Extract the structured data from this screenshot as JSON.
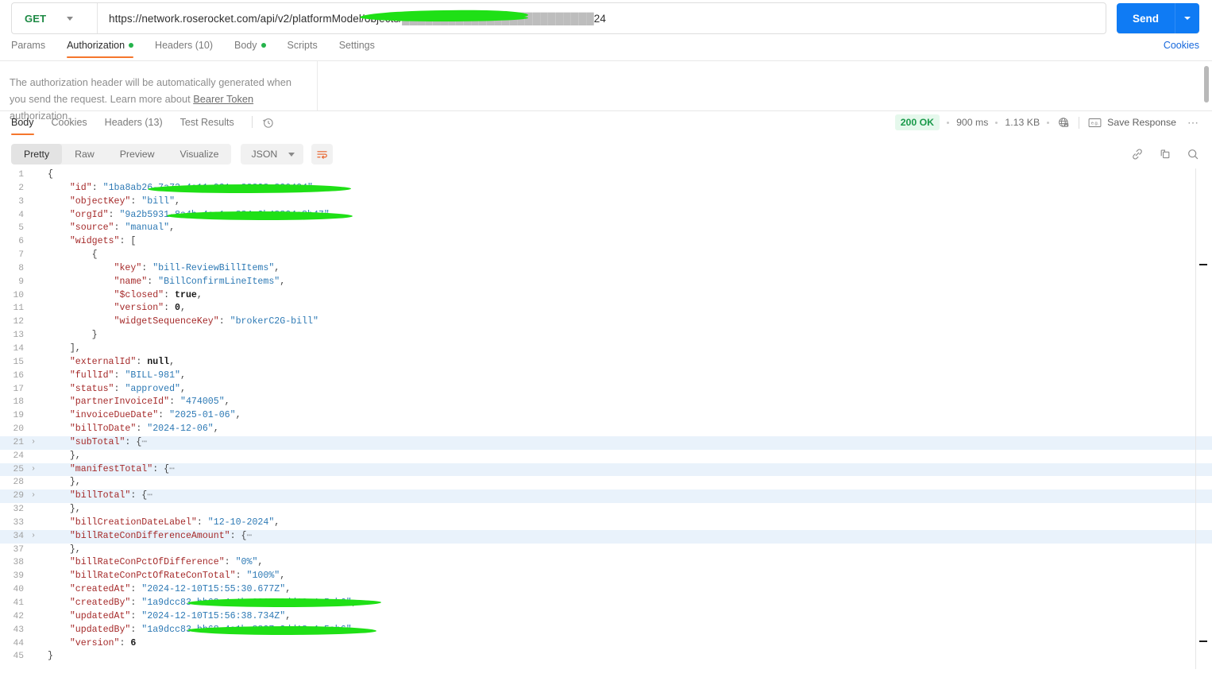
{
  "request": {
    "method": "GET",
    "url": "https://network.roserocket.com/api/v2/platformModel/objects/",
    "url_tail": "24",
    "send_label": "Send",
    "tabs": [
      {
        "label": "Params",
        "active": false,
        "dot": false
      },
      {
        "label": "Authorization",
        "active": true,
        "dot": true
      },
      {
        "label": "Headers (10)",
        "active": false,
        "dot": false
      },
      {
        "label": "Body",
        "active": false,
        "dot": true
      },
      {
        "label": "Scripts",
        "active": false,
        "dot": false
      },
      {
        "label": "Settings",
        "active": false,
        "dot": false
      }
    ],
    "cookies_link": "Cookies"
  },
  "auth": {
    "text_before": "The authorization header will be automatically generated when you send the request. Learn more about ",
    "link": "Bearer Token",
    "text_after": " authorization."
  },
  "response": {
    "tabs": [
      {
        "label": "Body",
        "active": true
      },
      {
        "label": "Cookies",
        "active": false
      },
      {
        "label": "Headers (13)",
        "active": false
      },
      {
        "label": "Test Results",
        "active": false
      }
    ],
    "status": "200 OK",
    "time": "900 ms",
    "size": "1.13 KB",
    "save_response": "Save Response",
    "status_color": "#1b9a4b",
    "status_bg": "#e5f8ec"
  },
  "format": {
    "segments": [
      {
        "label": "Pretty",
        "active": true
      },
      {
        "label": "Raw",
        "active": false
      },
      {
        "label": "Preview",
        "active": false
      },
      {
        "label": "Visualize",
        "active": false
      }
    ],
    "language": "JSON",
    "accent": "#f5762c"
  },
  "code": {
    "lines": [
      {
        "no": "1",
        "indent": 0,
        "fold": "",
        "hl": false,
        "tokens": [
          {
            "t": "{",
            "c": "p"
          }
        ]
      },
      {
        "no": "2",
        "indent": 1,
        "fold": "",
        "hl": false,
        "redact": "r-id",
        "tokens": [
          {
            "t": "\"id\"",
            "c": "k"
          },
          {
            "t": ": ",
            "c": "p"
          },
          {
            "t": "\"1ba8ab26-7a73-4a11-921a-88828a820424\"",
            "c": "s"
          },
          {
            "t": ",",
            "c": "p"
          }
        ]
      },
      {
        "no": "3",
        "indent": 1,
        "fold": "",
        "hl": false,
        "tokens": [
          {
            "t": "\"objectKey\"",
            "c": "k"
          },
          {
            "t": ": ",
            "c": "p"
          },
          {
            "t": "\"bill\"",
            "c": "s"
          },
          {
            "t": ",",
            "c": "p"
          }
        ]
      },
      {
        "no": "4",
        "indent": 1,
        "fold": "",
        "hl": false,
        "redact": "r-org",
        "tokens": [
          {
            "t": "\"orgId\"",
            "c": "k"
          },
          {
            "t": ": ",
            "c": "p"
          },
          {
            "t": "\"9a2b5931-8a4b-4aa1-a884-3b48824a8b47\"",
            "c": "s"
          },
          {
            "t": ",",
            "c": "p"
          }
        ]
      },
      {
        "no": "5",
        "indent": 1,
        "fold": "",
        "hl": false,
        "tokens": [
          {
            "t": "\"source\"",
            "c": "k"
          },
          {
            "t": ": ",
            "c": "p"
          },
          {
            "t": "\"manual\"",
            "c": "s"
          },
          {
            "t": ",",
            "c": "p"
          }
        ]
      },
      {
        "no": "6",
        "indent": 1,
        "fold": "",
        "hl": false,
        "tokens": [
          {
            "t": "\"widgets\"",
            "c": "k"
          },
          {
            "t": ": ",
            "c": "p"
          },
          {
            "t": "[",
            "c": "p"
          }
        ]
      },
      {
        "no": "7",
        "indent": 2,
        "fold": "",
        "hl": false,
        "tokens": [
          {
            "t": "{",
            "c": "p"
          }
        ]
      },
      {
        "no": "8",
        "indent": 3,
        "fold": "",
        "hl": false,
        "tokens": [
          {
            "t": "\"key\"",
            "c": "k"
          },
          {
            "t": ": ",
            "c": "p"
          },
          {
            "t": "\"bill-ReviewBillItems\"",
            "c": "s"
          },
          {
            "t": ",",
            "c": "p"
          }
        ]
      },
      {
        "no": "9",
        "indent": 3,
        "fold": "",
        "hl": false,
        "tokens": [
          {
            "t": "\"name\"",
            "c": "k"
          },
          {
            "t": ": ",
            "c": "p"
          },
          {
            "t": "\"BillConfirmLineItems\"",
            "c": "s"
          },
          {
            "t": ",",
            "c": "p"
          }
        ]
      },
      {
        "no": "10",
        "indent": 3,
        "fold": "",
        "hl": false,
        "tokens": [
          {
            "t": "\"$closed\"",
            "c": "k"
          },
          {
            "t": ": ",
            "c": "p"
          },
          {
            "t": "true",
            "c": "n"
          },
          {
            "t": ",",
            "c": "p"
          }
        ]
      },
      {
        "no": "11",
        "indent": 3,
        "fold": "",
        "hl": false,
        "tokens": [
          {
            "t": "\"version\"",
            "c": "k"
          },
          {
            "t": ": ",
            "c": "p"
          },
          {
            "t": "0",
            "c": "n"
          },
          {
            "t": ",",
            "c": "p"
          }
        ]
      },
      {
        "no": "12",
        "indent": 3,
        "fold": "",
        "hl": false,
        "tokens": [
          {
            "t": "\"widgetSequenceKey\"",
            "c": "k"
          },
          {
            "t": ": ",
            "c": "p"
          },
          {
            "t": "\"brokerC2G-bill\"",
            "c": "s"
          }
        ]
      },
      {
        "no": "13",
        "indent": 2,
        "fold": "",
        "hl": false,
        "tokens": [
          {
            "t": "}",
            "c": "p"
          }
        ]
      },
      {
        "no": "14",
        "indent": 1,
        "fold": "",
        "hl": false,
        "tokens": [
          {
            "t": "],",
            "c": "p"
          }
        ]
      },
      {
        "no": "15",
        "indent": 1,
        "fold": "",
        "hl": false,
        "tokens": [
          {
            "t": "\"externalId\"",
            "c": "k"
          },
          {
            "t": ": ",
            "c": "p"
          },
          {
            "t": "null",
            "c": "n"
          },
          {
            "t": ",",
            "c": "p"
          }
        ]
      },
      {
        "no": "16",
        "indent": 1,
        "fold": "",
        "hl": false,
        "tokens": [
          {
            "t": "\"fullId\"",
            "c": "k"
          },
          {
            "t": ": ",
            "c": "p"
          },
          {
            "t": "\"BILL-981\"",
            "c": "s"
          },
          {
            "t": ",",
            "c": "p"
          }
        ]
      },
      {
        "no": "17",
        "indent": 1,
        "fold": "",
        "hl": false,
        "tokens": [
          {
            "t": "\"status\"",
            "c": "k"
          },
          {
            "t": ": ",
            "c": "p"
          },
          {
            "t": "\"approved\"",
            "c": "s"
          },
          {
            "t": ",",
            "c": "p"
          }
        ]
      },
      {
        "no": "18",
        "indent": 1,
        "fold": "",
        "hl": false,
        "tokens": [
          {
            "t": "\"partnerInvoiceId\"",
            "c": "k"
          },
          {
            "t": ": ",
            "c": "p"
          },
          {
            "t": "\"474005\"",
            "c": "s"
          },
          {
            "t": ",",
            "c": "p"
          }
        ]
      },
      {
        "no": "19",
        "indent": 1,
        "fold": "",
        "hl": false,
        "tokens": [
          {
            "t": "\"invoiceDueDate\"",
            "c": "k"
          },
          {
            "t": ": ",
            "c": "p"
          },
          {
            "t": "\"2025-01-06\"",
            "c": "s"
          },
          {
            "t": ",",
            "c": "p"
          }
        ]
      },
      {
        "no": "20",
        "indent": 1,
        "fold": "",
        "hl": false,
        "tokens": [
          {
            "t": "\"billToDate\"",
            "c": "k"
          },
          {
            "t": ": ",
            "c": "p"
          },
          {
            "t": "\"2024-12-06\"",
            "c": "s"
          },
          {
            "t": ",",
            "c": "p"
          }
        ]
      },
      {
        "no": "21",
        "indent": 1,
        "fold": "›",
        "hl": true,
        "tokens": [
          {
            "t": "\"subTotal\"",
            "c": "k"
          },
          {
            "t": ": ",
            "c": "p"
          },
          {
            "t": "{",
            "c": "p"
          },
          {
            "t": "⋯",
            "c": "fade"
          }
        ]
      },
      {
        "no": "24",
        "indent": 1,
        "fold": "",
        "hl": false,
        "tokens": [
          {
            "t": "},",
            "c": "p"
          }
        ]
      },
      {
        "no": "25",
        "indent": 1,
        "fold": "›",
        "hl": true,
        "tokens": [
          {
            "t": "\"manifestTotal\"",
            "c": "k"
          },
          {
            "t": ": ",
            "c": "p"
          },
          {
            "t": "{",
            "c": "p"
          },
          {
            "t": "⋯",
            "c": "fade"
          }
        ]
      },
      {
        "no": "28",
        "indent": 1,
        "fold": "",
        "hl": false,
        "tokens": [
          {
            "t": "},",
            "c": "p"
          }
        ]
      },
      {
        "no": "29",
        "indent": 1,
        "fold": "›",
        "hl": true,
        "tokens": [
          {
            "t": "\"billTotal\"",
            "c": "k"
          },
          {
            "t": ": ",
            "c": "p"
          },
          {
            "t": "{",
            "c": "p"
          },
          {
            "t": "⋯",
            "c": "fade"
          }
        ]
      },
      {
        "no": "32",
        "indent": 1,
        "fold": "",
        "hl": false,
        "tokens": [
          {
            "t": "},",
            "c": "p"
          }
        ]
      },
      {
        "no": "33",
        "indent": 1,
        "fold": "",
        "hl": false,
        "tokens": [
          {
            "t": "\"billCreationDateLabel\"",
            "c": "k"
          },
          {
            "t": ": ",
            "c": "p"
          },
          {
            "t": "\"12-10-2024\"",
            "c": "s"
          },
          {
            "t": ",",
            "c": "p"
          }
        ]
      },
      {
        "no": "34",
        "indent": 1,
        "fold": "›",
        "hl": true,
        "tokens": [
          {
            "t": "\"billRateConDifferenceAmount\"",
            "c": "k"
          },
          {
            "t": ": ",
            "c": "p"
          },
          {
            "t": "{",
            "c": "p"
          },
          {
            "t": "⋯",
            "c": "fade"
          }
        ]
      },
      {
        "no": "37",
        "indent": 1,
        "fold": "",
        "hl": false,
        "tokens": [
          {
            "t": "},",
            "c": "p"
          }
        ]
      },
      {
        "no": "38",
        "indent": 1,
        "fold": "",
        "hl": false,
        "tokens": [
          {
            "t": "\"billRateConPctOfDifference\"",
            "c": "k"
          },
          {
            "t": ": ",
            "c": "p"
          },
          {
            "t": "\"0%\"",
            "c": "s"
          },
          {
            "t": ",",
            "c": "p"
          }
        ]
      },
      {
        "no": "39",
        "indent": 1,
        "fold": "",
        "hl": false,
        "tokens": [
          {
            "t": "\"billRateConPctOfRateConTotal\"",
            "c": "k"
          },
          {
            "t": ": ",
            "c": "p"
          },
          {
            "t": "\"100%\"",
            "c": "s"
          },
          {
            "t": ",",
            "c": "p"
          }
        ]
      },
      {
        "no": "40",
        "indent": 1,
        "fold": "",
        "hl": false,
        "tokens": [
          {
            "t": "\"createdAt\"",
            "c": "k"
          },
          {
            "t": ": ",
            "c": "p"
          },
          {
            "t": "\"2024-12-10T15:55:30.677Z\"",
            "c": "s"
          },
          {
            "t": ",",
            "c": "p"
          }
        ]
      },
      {
        "no": "41",
        "indent": 1,
        "fold": "",
        "hl": false,
        "redact": "r-created",
        "tokens": [
          {
            "t": "\"createdBy\"",
            "c": "k"
          },
          {
            "t": ": ",
            "c": "p"
          },
          {
            "t": "\"1a9dcc83-bb68-4a1b-8827-3dd18a4a5ab6\"",
            "c": "s"
          },
          {
            "t": ",",
            "c": "p"
          }
        ]
      },
      {
        "no": "42",
        "indent": 1,
        "fold": "",
        "hl": false,
        "tokens": [
          {
            "t": "\"updatedAt\"",
            "c": "k"
          },
          {
            "t": ": ",
            "c": "p"
          },
          {
            "t": "\"2024-12-10T15:56:38.734Z\"",
            "c": "s"
          },
          {
            "t": ",",
            "c": "p"
          }
        ]
      },
      {
        "no": "43",
        "indent": 1,
        "fold": "",
        "hl": false,
        "redact": "r-updated",
        "tokens": [
          {
            "t": "\"updatedBy\"",
            "c": "k"
          },
          {
            "t": ": ",
            "c": "p"
          },
          {
            "t": "\"1a9dcc83-bb68-4a1b-8827-3dd18a4a5ab6\"",
            "c": "s"
          },
          {
            "t": ",",
            "c": "p"
          }
        ]
      },
      {
        "no": "44",
        "indent": 1,
        "fold": "",
        "hl": false,
        "tokens": [
          {
            "t": "\"version\"",
            "c": "k"
          },
          {
            "t": ": ",
            "c": "p"
          },
          {
            "t": "6",
            "c": "n"
          }
        ]
      },
      {
        "no": "45",
        "indent": 0,
        "fold": "",
        "hl": false,
        "tokens": [
          {
            "t": "}",
            "c": "p"
          }
        ]
      }
    ]
  }
}
